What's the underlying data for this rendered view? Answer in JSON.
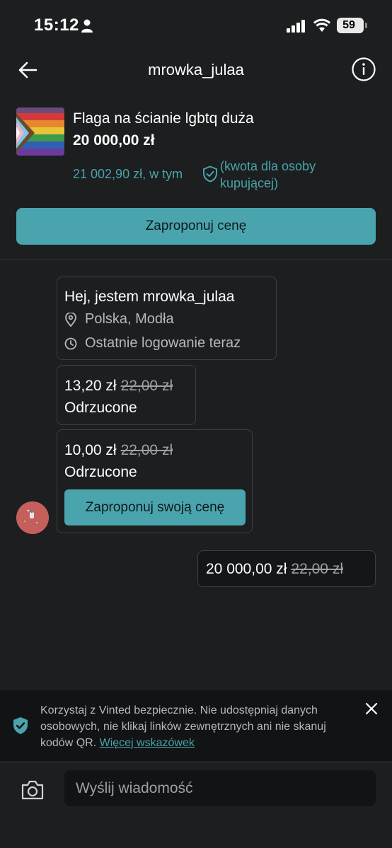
{
  "status_bar": {
    "time": "15:12",
    "battery": "59"
  },
  "header": {
    "title": "mrowka_julaa"
  },
  "product": {
    "title": "Flaga na ścianie lgbtq duża",
    "price": "20 000,00 zł",
    "total": "21 002,90 zł, w tym",
    "buyer_note": "(kwota dla osoby kupującej)"
  },
  "offer_button": "Zaproponuj cenę",
  "intro": {
    "title": "Hej, jestem mrowka_julaa",
    "location": "Polska, Modła",
    "last_login": "Ostatnie logowanie teraz"
  },
  "offers": [
    {
      "price": "13,20 zł",
      "old": "22,00 zł",
      "status": "Odrzucone"
    },
    {
      "price": "10,00 zł",
      "old": "22,00 zł",
      "status": "Odrzucone"
    }
  ],
  "counter_button": "Zaproponuj swoją cenę",
  "my_offer": {
    "price": "20 000,00 zł",
    "old": "22,00 zł"
  },
  "safety": {
    "text": "Korzystaj z Vinted bezpiecznie. Nie udostępniaj danych osobowych, nie klikaj linków zewnętrznych ani nie skanuj kodów QR.",
    "link": "Więcej wskazówek"
  },
  "composer": {
    "placeholder": "Wyślij wiadomość"
  },
  "colors": {
    "accent": "#4aa4ad",
    "background": "#1c1e1f",
    "banner": "#121314"
  }
}
